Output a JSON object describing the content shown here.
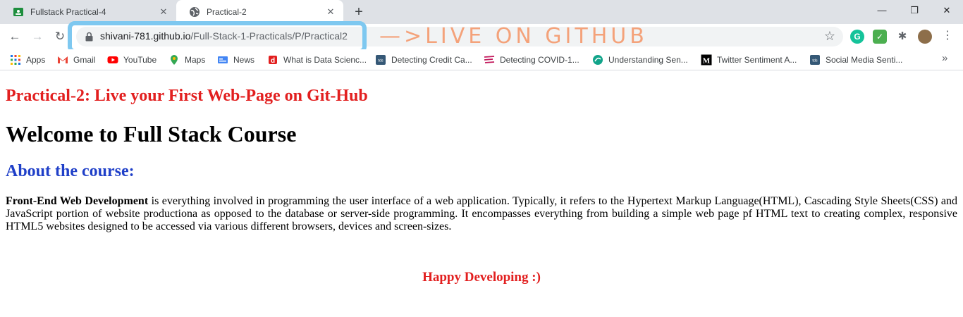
{
  "tabs": [
    {
      "title": "Fullstack Practical-4",
      "favicon": "classroom-icon",
      "active": false
    },
    {
      "title": "Practical-2",
      "favicon": "globe-icon",
      "active": true
    }
  ],
  "window_controls": {
    "minimize": "—",
    "restore": "❐",
    "close": "✕"
  },
  "toolbar": {
    "url_host": "shivani-781.github.io",
    "url_path": "/Full-Stack-1-Practicals/P/Practical2",
    "annotation": "—>LIVE ON GITHUB",
    "annotation_color": "#f4a27a",
    "highlight_color": "#7ec8f0"
  },
  "bookmarks": [
    {
      "label": "Apps",
      "icon": "apps-grid-icon"
    },
    {
      "label": "Gmail",
      "icon": "gmail-icon"
    },
    {
      "label": "YouTube",
      "icon": "youtube-icon"
    },
    {
      "label": "Maps",
      "icon": "maps-icon"
    },
    {
      "label": "News",
      "icon": "news-icon"
    },
    {
      "label": "What is Data Scienc...",
      "icon": "d-icon"
    },
    {
      "label": "Detecting Credit Ca...",
      "icon": "tds-icon"
    },
    {
      "label": "Detecting COVID-1...",
      "icon": "covid-icon"
    },
    {
      "label": "Understanding Sen...",
      "icon": "sentiment-icon"
    },
    {
      "label": "Twitter Sentiment A...",
      "icon": "medium-icon"
    },
    {
      "label": "Social Media Senti...",
      "icon": "tds-icon"
    }
  ],
  "page": {
    "practical_heading": "Practical-2: Live your First Web-Page on Git-Hub",
    "welcome_heading": "Welcome to Full Stack Course",
    "about_heading": "About the course:",
    "para_bold": "Front-End Web Development",
    "para_text": " is everything involved in programming the user interface of a web application. Typically, it refers to the Hypertext Markup Language(HTML), Cascading Style Sheets(CSS) and JavaScript portion of website productiona as opposed to the database or server-side programming. It encompasses everything from building a simple web page pf HTML text to creating complex, responsive HTML5 websites designed to be accessed via various different browsers, devices and screen-sizes.",
    "footer": "Happy Developing :)"
  },
  "colors": {
    "red": "#e21f1f",
    "blue": "#1f3fc8"
  }
}
